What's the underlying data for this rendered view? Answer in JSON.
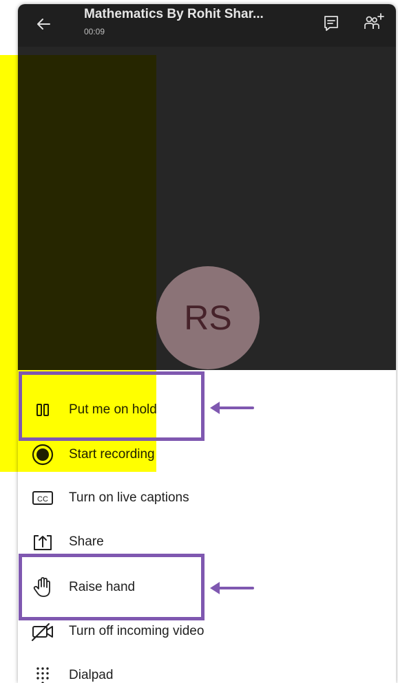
{
  "header": {
    "title": "Mathematics By Rohit Shar...",
    "timer": "00:09"
  },
  "participant": {
    "initials": "RS"
  },
  "menu": {
    "items": [
      {
        "label": "Put me on hold",
        "icon": "pause-icon"
      },
      {
        "label": "Start recording",
        "icon": "record-icon"
      },
      {
        "label": "Turn on live captions",
        "icon": "cc-icon"
      },
      {
        "label": "Share",
        "icon": "share-icon"
      },
      {
        "label": "Raise hand",
        "icon": "hand-icon"
      },
      {
        "label": "Turn off incoming video",
        "icon": "video-off-icon"
      },
      {
        "label": "Dialpad",
        "icon": "dialpad-icon"
      }
    ]
  },
  "colors": {
    "highlight": "#ffff00",
    "annotation": "#7f58b0",
    "header_bg": "#1f1f1f",
    "stage_bg": "#262626",
    "avatar_bg": "#8b7377"
  }
}
